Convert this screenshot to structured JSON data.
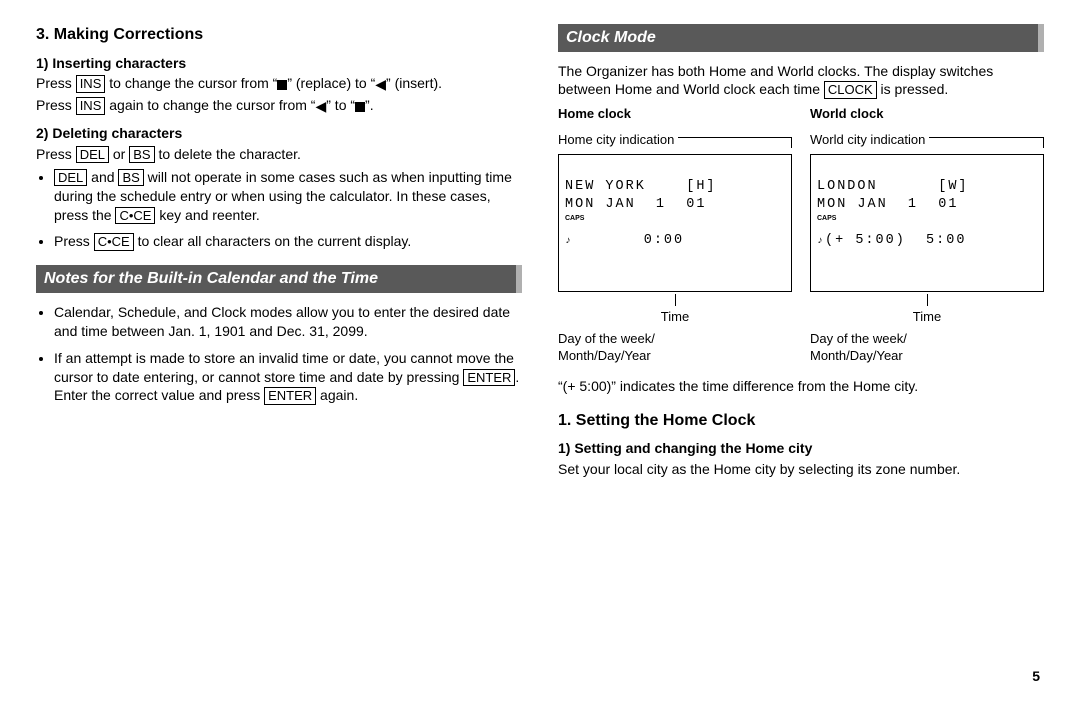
{
  "page_number": "5",
  "left": {
    "h_making": "3. Making Corrections",
    "ins_h": "1) Inserting characters",
    "ins_p1a": "Press ",
    "ins_key1": "INS",
    "ins_p1b": " to change the cursor from “",
    "ins_p1c": "” (replace) to “",
    "ins_p1d": "” (insert).",
    "ins_p2a": "Press ",
    "ins_key2": "INS",
    "ins_p2b": " again to change the cursor from “",
    "ins_p2c": "” to “",
    "ins_p2d": "”.",
    "del_h": "2) Deleting characters",
    "del_p1a": "Press ",
    "del_key1": "DEL",
    "del_or": " or ",
    "del_key2": "BS",
    "del_p1b": " to delete the character.",
    "del_b1a": "",
    "del_b1_key1": "DEL",
    "del_b1_and": " and ",
    "del_b1_key2": "BS",
    "del_b1_rest": " will not operate in some cases such as when inputting time during the schedule entry or when using the calculator. In these cases, press the ",
    "del_b1_key3": "C•CE",
    "del_b1_end": " key and reenter.",
    "del_b2a": "Press ",
    "del_b2_key": "C•CE",
    "del_b2b": " to clear all characters on the current display.",
    "notes_banner": "Notes for the Built-in Calendar and the Time",
    "notes_b1": "Calendar, Schedule, and Clock modes allow you to enter the desired date and time between Jan. 1, 1901 and Dec. 31, 2099.",
    "notes_b2a": "If an attempt is made to store an invalid time or date, you cannot move the cursor to date entering, or cannot store time and date by pressing ",
    "notes_b2_key1": "ENTER",
    "notes_b2b": ". Enter the correct value and press ",
    "notes_b2_key2": "ENTER",
    "notes_b2c": " again."
  },
  "right": {
    "clock_banner": "Clock Mode",
    "intro_a": "The Organizer has both Home and World clocks. The display switches between Home and World clock each time ",
    "intro_key": "CLOCK",
    "intro_b": " is pressed.",
    "home_title": "Home clock",
    "world_title": "World clock",
    "home_indic": "Home city indication",
    "world_indic": "World city indication",
    "home_lcd_l1": "NEW YORK    [H]",
    "home_lcd_l2": "MON JAN  1  01",
    "home_lcd_l3": "       0:00",
    "world_lcd_l1": "LONDON      [W]",
    "world_lcd_l2": "MON JAN  1  01",
    "world_lcd_l3": "(+ 5:00)  5:00",
    "caps": "CAPS",
    "time_label": "Time",
    "day_label": "Day of the week/\nMonth/Day/Year",
    "diff_note": "“(+ 5:00)” indicates the time difference from the Home city.",
    "set_h": "1. Setting the Home Clock",
    "set_sub": "1) Setting and changing the Home city",
    "set_p": "Set your local city as the Home city by selecting its zone number."
  }
}
